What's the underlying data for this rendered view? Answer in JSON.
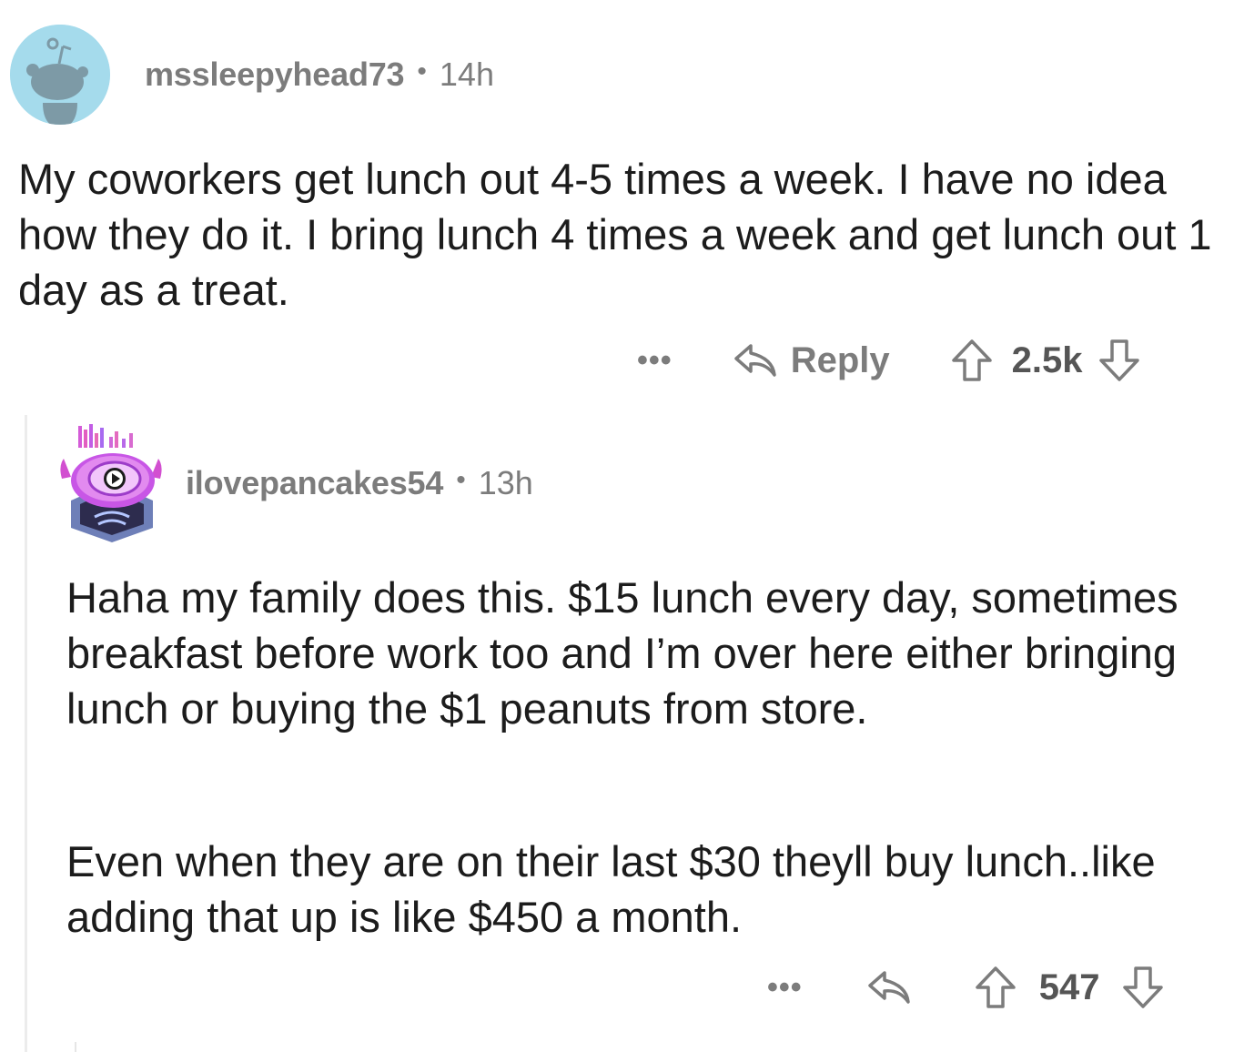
{
  "comments": [
    {
      "username": "mssleepyhead73",
      "separator": "•",
      "time": "14h",
      "body": "My coworkers get lunch out 4-5 times a week. I have no idea how they do it. I bring lunch 4 times a week and get lunch out 1 day as a treat.",
      "more_label": "•••",
      "reply_label": "Reply",
      "votes": "2.5k"
    },
    {
      "username": "ilovepancakes54",
      "separator": "•",
      "time": "13h",
      "body_p1": "Haha my family does this. $15 lunch every day, sometimes breakfast before work too and I’m over here either bringing lunch or buying the $1 peanuts from store.",
      "body_p2": "Even when they are on their last $30 theyll buy lunch..like adding that up is like $450 a month.",
      "more_label": "•••",
      "votes": "547"
    }
  ],
  "colors": {
    "meta_gray": "#7c7c7c",
    "body_text": "#1c1c1c",
    "avatar1_bg": "#a5dbec",
    "thread_line": "#ececec"
  },
  "icons": {
    "reply": "reply-arrow-icon",
    "upvote": "upvote-arrow-icon",
    "downvote": "downvote-arrow-icon"
  }
}
